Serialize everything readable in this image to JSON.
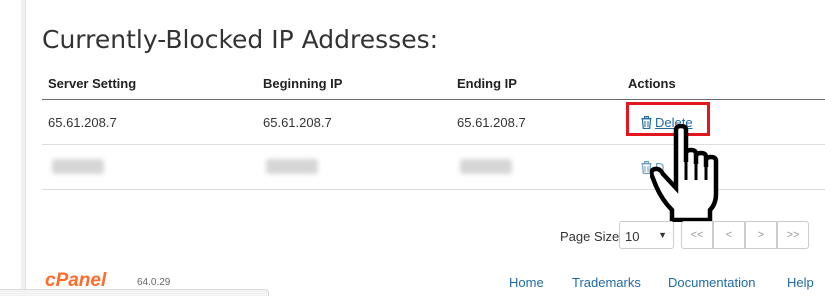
{
  "page": {
    "title": "Currently-Blocked IP Addresses:"
  },
  "table": {
    "headers": [
      "Server Setting",
      "Beginning IP",
      "Ending IP",
      "Actions"
    ],
    "rows": [
      {
        "server_setting": "65.61.208.7",
        "beginning_ip": "65.61.208.7",
        "ending_ip": "65.61.208.7",
        "action": "Delete"
      },
      {
        "server_setting": "",
        "beginning_ip": "",
        "ending_ip": "",
        "action": "D"
      }
    ]
  },
  "pagination": {
    "page_size_label": "Page Size",
    "page_size_value": "10",
    "buttons": [
      "<<",
      "<",
      ">",
      ">>"
    ]
  },
  "footer": {
    "logo_text": "cPanel",
    "version": "64.0.29",
    "links": [
      "Home",
      "Trademarks",
      "Documentation",
      "Help"
    ]
  },
  "colors": {
    "link": "#1f6aa5",
    "highlight": "#e3161f",
    "logo": "#ff6c2c"
  },
  "icons": [
    "trash-icon",
    "hand-pointer-cursor-icon",
    "chevron-down-icon"
  ]
}
